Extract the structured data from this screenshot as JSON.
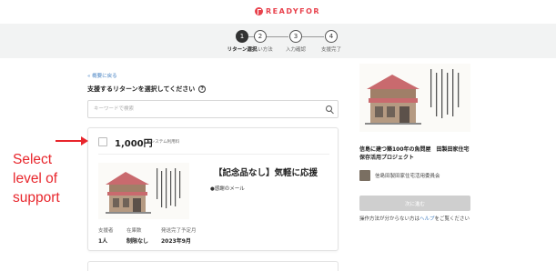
{
  "header": {
    "logo_text": "READYFOR"
  },
  "steps": [
    {
      "number": "1",
      "label": "リターン選択"
    },
    {
      "number": "2",
      "label": "支払い方法"
    },
    {
      "number": "3",
      "label": "入力確認"
    },
    {
      "number": "4",
      "label": "支援完了"
    }
  ],
  "main": {
    "back_link": "« 概要に戻る",
    "section_title": "支援するリターンを選択してください",
    "search_placeholder": "キーワードで検索",
    "reward": {
      "price": "1,000円",
      "price_note": "+システム利用料",
      "title": "【記念品なし】気軽に応援",
      "item": "●感謝のメール",
      "meta": [
        {
          "label": "支援者",
          "value": "1人"
        },
        {
          "label": "在庫数",
          "value": "制限なし"
        },
        {
          "label": "発送完了予定月",
          "value": "2023年9月"
        }
      ]
    }
  },
  "sidebar": {
    "project_title": "信島に建つ築100年の魚問屋　田製田家住宅保存活用プロジェクト",
    "org_name": "信島田製田家住宅活用委員会",
    "next_button": "次に進む",
    "help_prefix": "操作方法が分からない方は",
    "help_link": "ヘルプ",
    "help_suffix": "をご覧ください"
  },
  "annotation": {
    "line1": "Select",
    "line2": "level of",
    "line3": "support"
  },
  "colors": {
    "brand": "#e8424d",
    "annotation": "#e8262c",
    "link": "#4a84c4",
    "step_bar": "#f2f3f3"
  }
}
